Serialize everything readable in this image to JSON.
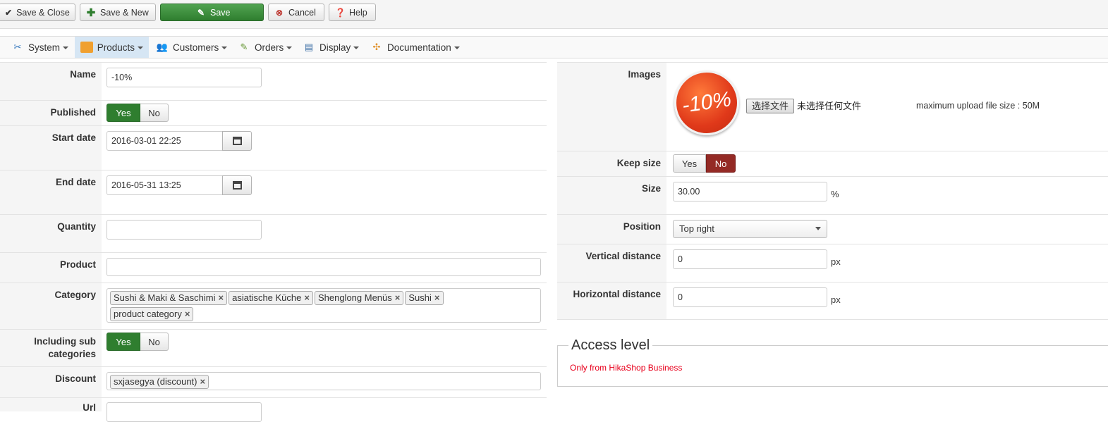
{
  "toolbar": {
    "save_close": "Save & Close",
    "save_new": "Save & New",
    "save": "Save",
    "cancel": "Cancel",
    "help": "Help"
  },
  "menu": {
    "items": [
      {
        "label": "System",
        "icon": "tools-icon"
      },
      {
        "label": "Products",
        "icon": "box-icon"
      },
      {
        "label": "Customers",
        "icon": "users-icon"
      },
      {
        "label": "Orders",
        "icon": "orders-icon"
      },
      {
        "label": "Display",
        "icon": "display-icon"
      },
      {
        "label": "Documentation",
        "icon": "documentation-icon"
      }
    ],
    "active": "Products"
  },
  "form": {
    "name_label": "Name",
    "name_value": "-10%",
    "published_label": "Published",
    "published_yes": "Yes",
    "published_no": "No",
    "start_label": "Start date",
    "start_value": "2016-03-01 22:25",
    "end_label": "End date",
    "end_value": "2016-05-31 13:25",
    "quantity_label": "Quantity",
    "quantity_value": "",
    "product_label": "Product",
    "product_value": "",
    "category_label": "Category",
    "categories": [
      "Sushi & Maki & Saschimi",
      "asiatische Küche",
      "Shenglong Menüs",
      "Sushi",
      "product category"
    ],
    "include_sub_label": "Including sub categories",
    "include_sub_yes": "Yes",
    "include_sub_no": "No",
    "discount_label": "Discount",
    "discounts": [
      "sxjasegya (discount)"
    ],
    "url_label": "Url"
  },
  "right": {
    "images_label": "Images",
    "badge_text": "-10%",
    "choose_file": "选择文件",
    "no_file": "未选择任何文件",
    "max_upload": "maximum upload file size : 50M",
    "keep_size_label": "Keep size",
    "keep_yes": "Yes",
    "keep_no": "No",
    "size_label": "Size",
    "size_value": "30.00",
    "size_unit": "%",
    "position_label": "Position",
    "position_value": "Top right",
    "vertical_label": "Vertical distance",
    "vertical_value": "0",
    "vertical_unit": "px",
    "horizontal_label": "Horizontal distance",
    "horizontal_value": "0",
    "horizontal_unit": "px",
    "access_legend": "Access level",
    "access_note": "Only from HikaShop Business"
  },
  "colors": {
    "green": "#2f7e2f",
    "red_active": "#942a25",
    "note_red": "#e8001c",
    "menu_active": "#d6e6f4"
  }
}
